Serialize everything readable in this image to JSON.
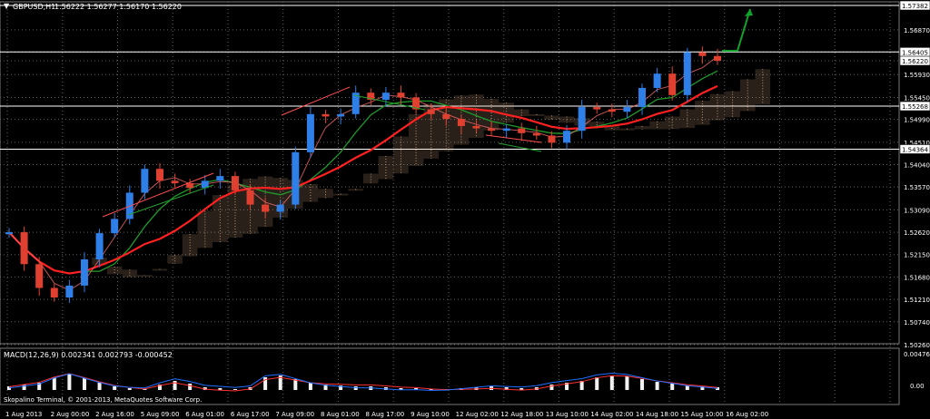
{
  "main_header": {
    "symbol_timeframe": "GBPUSD,H1",
    "ohlc": "1.56222 1.56277 1.56170 1.56220"
  },
  "macd_header": {
    "label": "MACD(12,26,9) 0.002341 0.002793 -0.000452"
  },
  "footer_text": "Skopalino Terminal, © 2001-2013, MetaQuotes Software Corp.",
  "colors": {
    "background": "#000000",
    "bull_candle": "#2f7fe8",
    "bear_candle": "#e04030",
    "ma_red": "#ff2020",
    "ma_green": "#1f9a2a",
    "ichimoku_cloud": "#e3b28a",
    "price_label_bg": "#ffffff"
  },
  "chart_data": {
    "type": "candlestick",
    "y_ticks": [
      "1.57382",
      "1.56870",
      "1.56405",
      "1.56220",
      "1.55930",
      "1.55450",
      "1.55268",
      "1.54990",
      "1.54510",
      "1.54364",
      "1.54040",
      "1.53570",
      "1.53090",
      "1.52620",
      "1.52150",
      "1.51680",
      "1.51210",
      "1.50740",
      "1.50260"
    ],
    "horizontal_levels": [
      "1.57382",
      "1.56405",
      "1.55268",
      "1.54364"
    ],
    "x_labels": [
      "1 Aug 2013",
      "2 Aug 00:00",
      "2 Aug 16:00",
      "5 Aug 09:00",
      "6 Aug 01:00",
      "6 Aug 17:00",
      "7 Aug 09:00",
      "8 Aug 01:00",
      "8 Aug 17:00",
      "9 Aug 10:00",
      "12 Aug 02:00",
      "12 Aug 18:00",
      "13 Aug 10:00",
      "14 Aug 02:00",
      "14 Aug 18:00",
      "15 Aug 10:00",
      "16 Aug 02:00"
    ],
    "price_series": [
      1.5262,
      1.5195,
      1.5145,
      1.5125,
      1.515,
      1.5205,
      1.526,
      1.529,
      1.5345,
      1.5395,
      1.537,
      1.5365,
      1.5355,
      1.537,
      1.538,
      1.535,
      1.532,
      1.5305,
      1.532,
      1.543,
      1.551,
      1.5505,
      1.551,
      1.5555,
      1.554,
      1.5555,
      1.5545,
      1.552,
      1.551,
      1.55,
      1.5485,
      1.548,
      1.5475,
      1.548,
      1.547,
      1.5465,
      1.545,
      1.5475,
      1.5525,
      1.552,
      1.5515,
      1.5525,
      1.5565,
      1.5595,
      1.555,
      1.564,
      1.5632,
      1.5622
    ],
    "macd_ticks": [
      "0.00476",
      "0.00"
    ]
  }
}
